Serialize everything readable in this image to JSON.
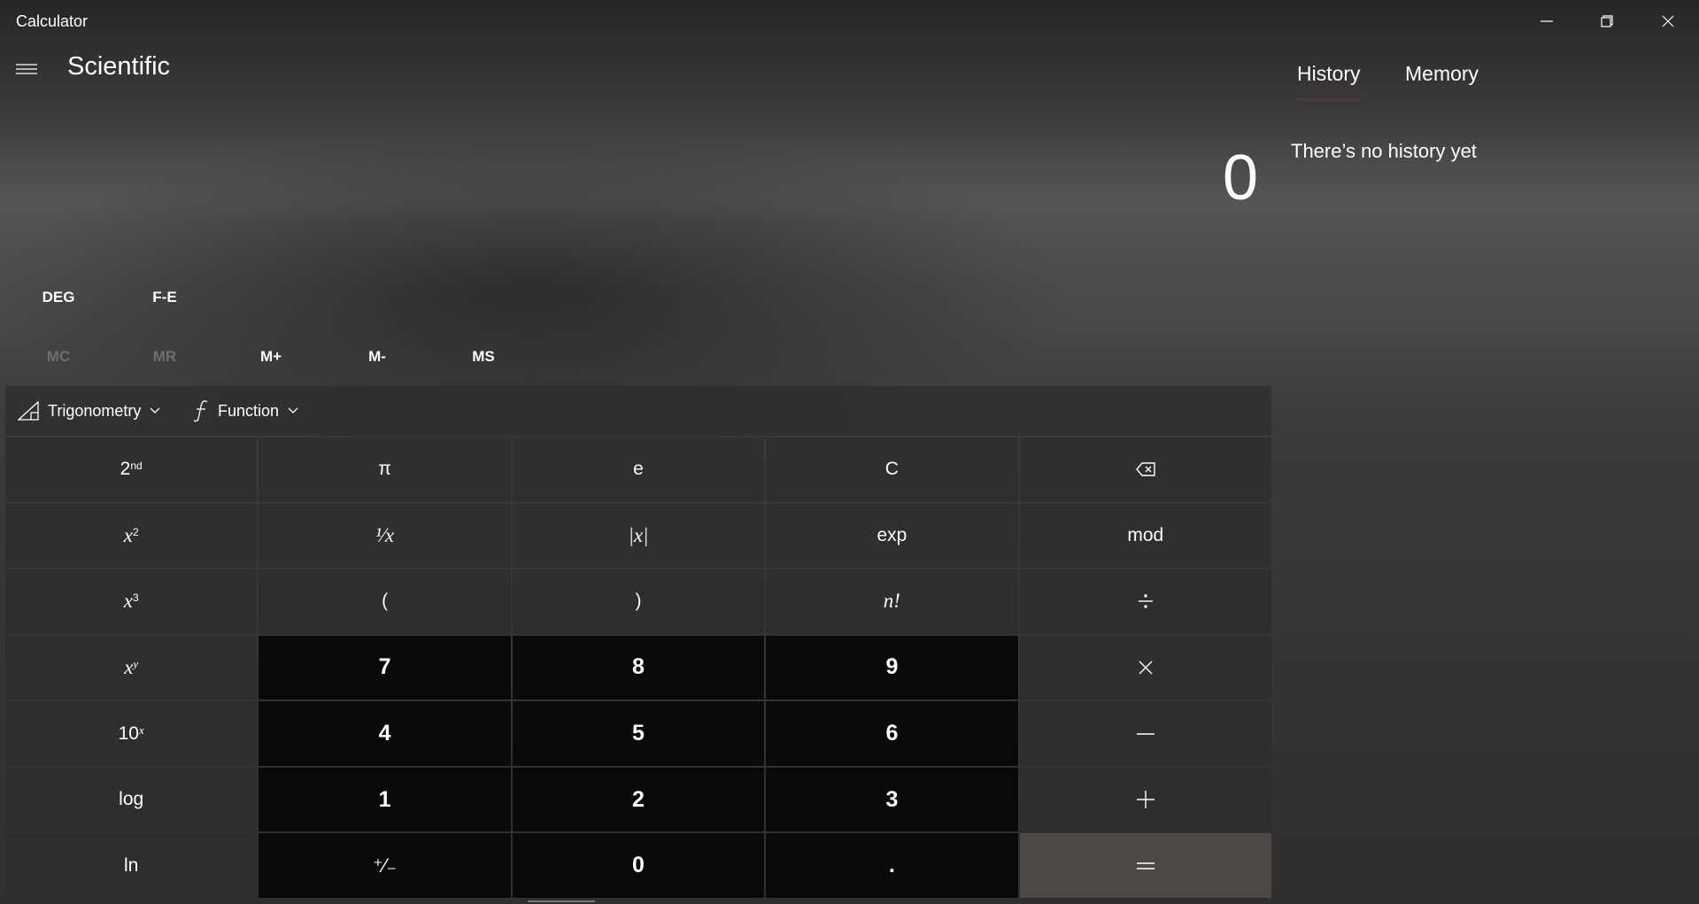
{
  "window": {
    "title": "Calculator",
    "controls": [
      "minimize",
      "restore",
      "close"
    ]
  },
  "header": {
    "menu_icon": "hamburger-menu-icon",
    "mode": "Scientific"
  },
  "display": {
    "value": "0"
  },
  "angle_row": {
    "deg": "DEG",
    "fe": "F-E"
  },
  "memory_row": {
    "mc": "MC",
    "mr": "MR",
    "mplus": "M+",
    "mminus": "M-",
    "ms": "MS",
    "disabled": [
      "MC",
      "MR"
    ]
  },
  "toolbar": {
    "trig": {
      "label": "Trigonometry",
      "icon": "triangle-ruler-icon"
    },
    "func": {
      "label": "Function",
      "icon": "function-f-icon"
    }
  },
  "keys": {
    "second": {
      "base": "2",
      "sup": "nd"
    },
    "pi": "π",
    "e": "e",
    "clear": "C",
    "backspace_icon": "backspace-icon",
    "x2": {
      "base": "x",
      "sup": "2"
    },
    "reciprocal": "¹⁄x",
    "abs": "|x|",
    "exp": "exp",
    "mod": "mod",
    "x3": {
      "base": "x",
      "sup": "3"
    },
    "lparen": "(",
    "rparen": ")",
    "fact": "n!",
    "divide_icon": "divide-icon",
    "xy": {
      "base": "x",
      "sup": "y"
    },
    "seven": "7",
    "eight": "8",
    "nine": "9",
    "multiply_icon": "multiply-icon",
    "tenx": {
      "base": "10",
      "sup": "x"
    },
    "four": "4",
    "five": "5",
    "six": "6",
    "minus_icon": "minus-icon",
    "log": "log",
    "one": "1",
    "two": "2",
    "three": "3",
    "plus_icon": "plus-icon",
    "ln": "ln",
    "negate": "⁺⁄₋",
    "zero": "0",
    "decimal": ".",
    "equals_icon": "equals-icon"
  },
  "panel": {
    "tabs": [
      {
        "label": "History",
        "active": true
      },
      {
        "label": "Memory",
        "active": false
      }
    ],
    "empty_message": "There’s no history yet"
  },
  "colors": {
    "number_key": "#080808",
    "function_key": "#2d2d2d",
    "equals_key": "#4e4c4a",
    "active_tab_underline": "#4b3e3a",
    "disabled_text": "#6e6e6e"
  }
}
